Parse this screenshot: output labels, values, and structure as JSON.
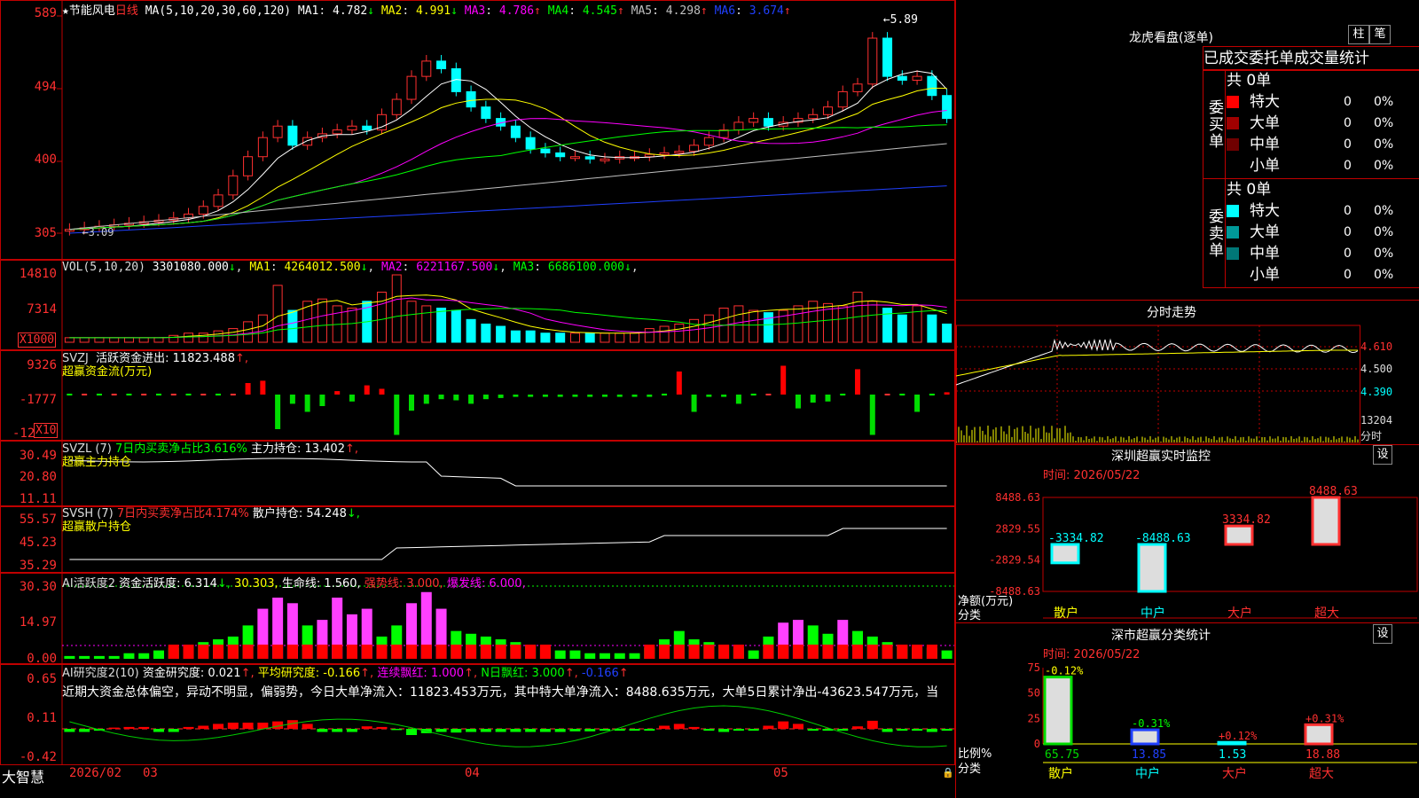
{
  "stock": {
    "name": "节能风电",
    "period": "日线",
    "ma_label": "MA(5,10,20,30,60,120)"
  },
  "ma": [
    {
      "key": "MA1",
      "value": "4.782",
      "arrow": "↓",
      "color": "#ffffff"
    },
    {
      "key": "MA2",
      "value": "4.991",
      "arrow": "↓",
      "color": "#ffff00"
    },
    {
      "key": "MA3",
      "value": "4.786",
      "arrow": "↑",
      "color": "#ff00ff"
    },
    {
      "key": "MA4",
      "value": "4.545",
      "arrow": "↑",
      "color": "#00ff00"
    },
    {
      "key": "MA5",
      "value": "4.298",
      "arrow": "↑",
      "color": "#c0c0c0"
    },
    {
      "key": "MA6",
      "value": "3.674",
      "arrow": "↑",
      "color": "#2040ff"
    }
  ],
  "price_axis": [
    "589",
    "494",
    "400",
    "305"
  ],
  "price_high_label": "5.89",
  "price_low_label": "3.09",
  "vol": {
    "label": "VOL(5,10,20)",
    "value": "3301080.000",
    "arrow": "↓",
    "ma": [
      {
        "key": "MA1",
        "value": "4264012.500",
        "arrow": "↓",
        "color": "#ffff00"
      },
      {
        "key": "MA2",
        "value": "6221167.500",
        "arrow": "↓",
        "color": "#ff00ff"
      },
      {
        "key": "MA3",
        "value": "6686100.000",
        "arrow": "↓",
        "color": "#00ff00"
      }
    ],
    "axis": [
      "14810",
      "7314"
    ],
    "unit": "X1000"
  },
  "svzj": {
    "code": "SVZJ",
    "text1": "活跃资金进出: 11823.488",
    "arrow": "↑,",
    "text2": "超赢资金流(万元)",
    "axis": [
      "9326",
      "-1777",
      "-12"
    ],
    "unit": "X10"
  },
  "svzl": {
    "code": "SVZL (7)",
    "text1": "7日内买卖净占比3.616%",
    "text2": "主力持仓: 13.402",
    "arrow": "↑,",
    "text3": "超赢主力持仓",
    "axis": [
      "30.49",
      "20.80",
      "11.11"
    ]
  },
  "svsh": {
    "code": "SVSH (7)",
    "text1": "7日内买卖净占比4.174%",
    "text2": "散户持仓: 54.248",
    "arrow": "↓,",
    "text3": "超赢散户持仓",
    "axis": [
      "55.57",
      "45.23",
      "35.29"
    ]
  },
  "ai1": {
    "title": "AI活跃度2",
    "t1": "资金活跃度: 6.314",
    "a1": "↓,",
    "t2": "30.303,",
    "t3": "生命线: 1.560,",
    "t4": "强势线: 3.000,",
    "t5": "爆发线: 6.000,",
    "axis": [
      "30.30",
      "14.97",
      "0.00"
    ]
  },
  "ai2": {
    "title": "AI研究度2(10)",
    "t1": "资金研究度: 0.021",
    "a1": "↑,",
    "t2": "平均研究度: -0.166",
    "a2": "↑,",
    "t3": "连续飘红: 1.000",
    "a3": "↑,",
    "t4": "N日飘红: 3.000",
    "a4": "↑,",
    "t5": "-0.166",
    "a5": "↑",
    "desc": "近期大资金总体偏空，异动不明显，偏弱势，今日大单净流入：11823.453万元，其中特大单净流入：8488.635万元，大单5日累计净出-43623.547万元，当",
    "axis": [
      "0.65",
      "0.11",
      "-0.42"
    ]
  },
  "date_axis": {
    "brand": "大智慧",
    "labels": [
      "2026/02",
      "03",
      "04",
      "05"
    ]
  },
  "right": {
    "lhkp_title": "龙虎看盘(逐单)",
    "btn_zhu": "柱",
    "btn_bi": "笔",
    "tabs": [
      "已成交",
      "委托单",
      "成交量统计"
    ],
    "buy": {
      "side": "委买单",
      "total": "共 0单",
      "rows": [
        {
          "label": "特大",
          "count": "0",
          "pct": "0%",
          "color": "#ff0000"
        },
        {
          "label": "大单",
          "count": "0",
          "pct": "0%",
          "color": "#a00000"
        },
        {
          "label": "中单",
          "count": "0",
          "pct": "0%",
          "color": "#700000"
        },
        {
          "label": "小单",
          "count": "0",
          "pct": "0%",
          "color": ""
        }
      ]
    },
    "sell": {
      "side": "委卖单",
      "total": "共 0单",
      "rows": [
        {
          "label": "特大",
          "count": "0",
          "pct": "0%",
          "color": "#00ffff"
        },
        {
          "label": "大单",
          "count": "0",
          "pct": "0%",
          "color": "#009999"
        },
        {
          "label": "中单",
          "count": "0",
          "pct": "0%",
          "color": "#007777"
        },
        {
          "label": "小单",
          "count": "0",
          "pct": "0%",
          "color": ""
        }
      ]
    },
    "fenshi": {
      "title": "分时走势",
      "price_axis": [
        "4.610",
        "4.500",
        "4.390"
      ],
      "vol_axis": [
        "13204",
        "分时"
      ]
    },
    "monitor": {
      "title": "深圳超赢实时监控",
      "btn": "设",
      "time": "时间: 2026/05/22",
      "axis": [
        "8488.63",
        "2829.55",
        "-2829.54",
        "-8488.63"
      ],
      "ylabel": "净额(万元)",
      "xlabel": "分类",
      "cats": [
        "散户",
        "中户",
        "大户",
        "超大"
      ],
      "values": [
        -3334.82,
        -8488.63,
        3334.82,
        8488.63
      ],
      "labels": [
        "-3334.82",
        "-8488.63",
        "3334.82",
        "8488.63"
      ]
    },
    "classify": {
      "title": "深市超赢分类统计",
      "btn": "设",
      "time": "时间: 2026/05/22",
      "axis": [
        "75",
        "50",
        "25",
        "0"
      ],
      "ylabel": "比例%",
      "xlabel": "分类",
      "cats": [
        "散户",
        "中户",
        "大户",
        "超大"
      ],
      "values": [
        65.75,
        13.85,
        1.53,
        18.88
      ],
      "bottom_labels": [
        "65.75",
        "13.85",
        "1.53",
        "18.88"
      ],
      "top_labels": [
        "-0.12%",
        "-0.31%",
        "+0.12%",
        "+0.31%"
      ]
    }
  },
  "chart_data": [
    {
      "type": "bar",
      "title": "深圳超赢实时监控",
      "categories": [
        "散户",
        "中户",
        "大户",
        "超大"
      ],
      "values": [
        -3334.82,
        -8488.63,
        3334.82,
        8488.63
      ],
      "ylabel": "净额(万元)",
      "xlabel": "分类",
      "ylim": [
        -8488.63,
        8488.63
      ]
    },
    {
      "type": "bar",
      "title": "深市超赢分类统计",
      "categories": [
        "散户",
        "中户",
        "大户",
        "超大"
      ],
      "values": [
        65.75,
        13.85,
        1.53,
        18.88
      ],
      "ylabel": "比例%",
      "xlabel": "分类",
      "ylim": [
        0,
        75
      ]
    }
  ]
}
